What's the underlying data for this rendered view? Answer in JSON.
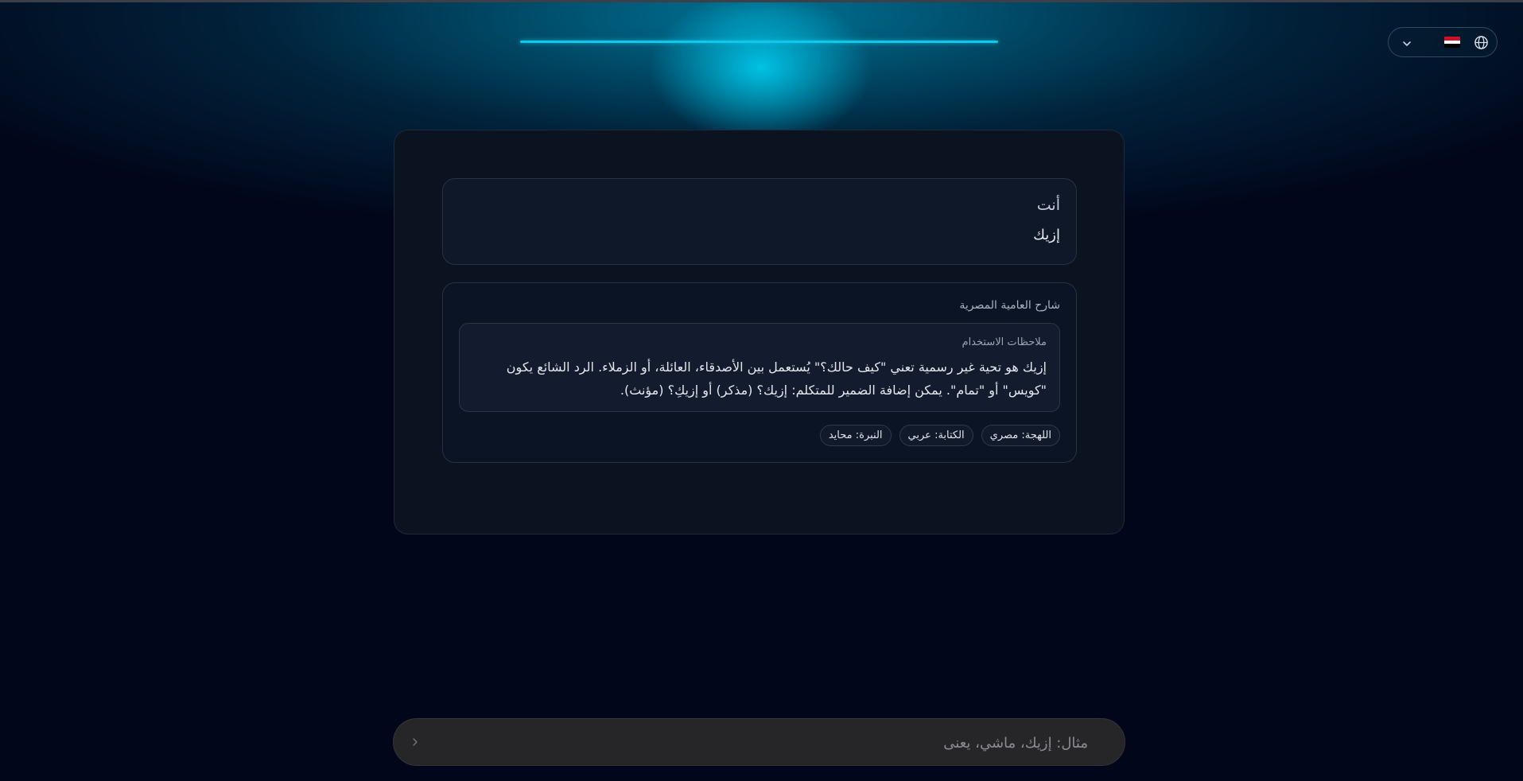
{
  "header": {
    "progress": 1.0,
    "accent_color": "#12c8ea",
    "language_switcher": {
      "globe_icon": "globe-icon",
      "flag_icon": "egypt-flag-icon",
      "chevron_icon": "chevron-down-icon",
      "flag_colors": [
        "#ce1126",
        "#ffffff",
        "#000000"
      ]
    }
  },
  "conversation": {
    "user_message": {
      "author": "أنت",
      "text": "إزيك"
    },
    "explanation": {
      "title": "شارح العامية المصرية",
      "notes_title": "ملاحظات الاستخدام",
      "notes_text": "إزيك هو تحية غير رسمية تعني \"كيف حالك؟\" يُستعمل بين الأصدقاء، العائلة، أو الزملاء. الرد الشائع يكون \"كويس\" أو \"تمام\". يمكن إضافة الضمير للمتكلم: إزيك؟ (مذكر) أو إزيكِ؟ (مؤنث).",
      "tags": [
        "اللهجة: مصري",
        "الكتابة: عربي",
        "النبرة: محايد"
      ]
    }
  },
  "composer": {
    "placeholder": "مثال: إزيك، ماشي، يعنى",
    "value": "",
    "send_icon": "chevron-left-icon"
  }
}
